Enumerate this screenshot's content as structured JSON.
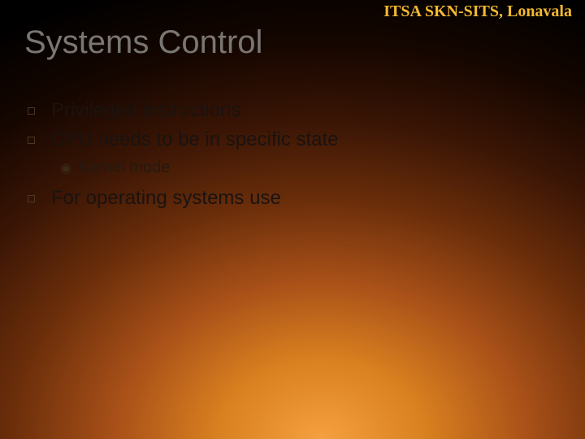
{
  "header": {
    "org_label": "ITSA SKN-SITS, Lonavala"
  },
  "slide": {
    "title": "Systems Control",
    "bullets": [
      {
        "text": "Privileged instructions"
      },
      {
        "text": "CPU needs to be in specific state",
        "sub": [
          {
            "text": "Kernel mode"
          }
        ]
      },
      {
        "text": "For operating systems use"
      }
    ]
  }
}
